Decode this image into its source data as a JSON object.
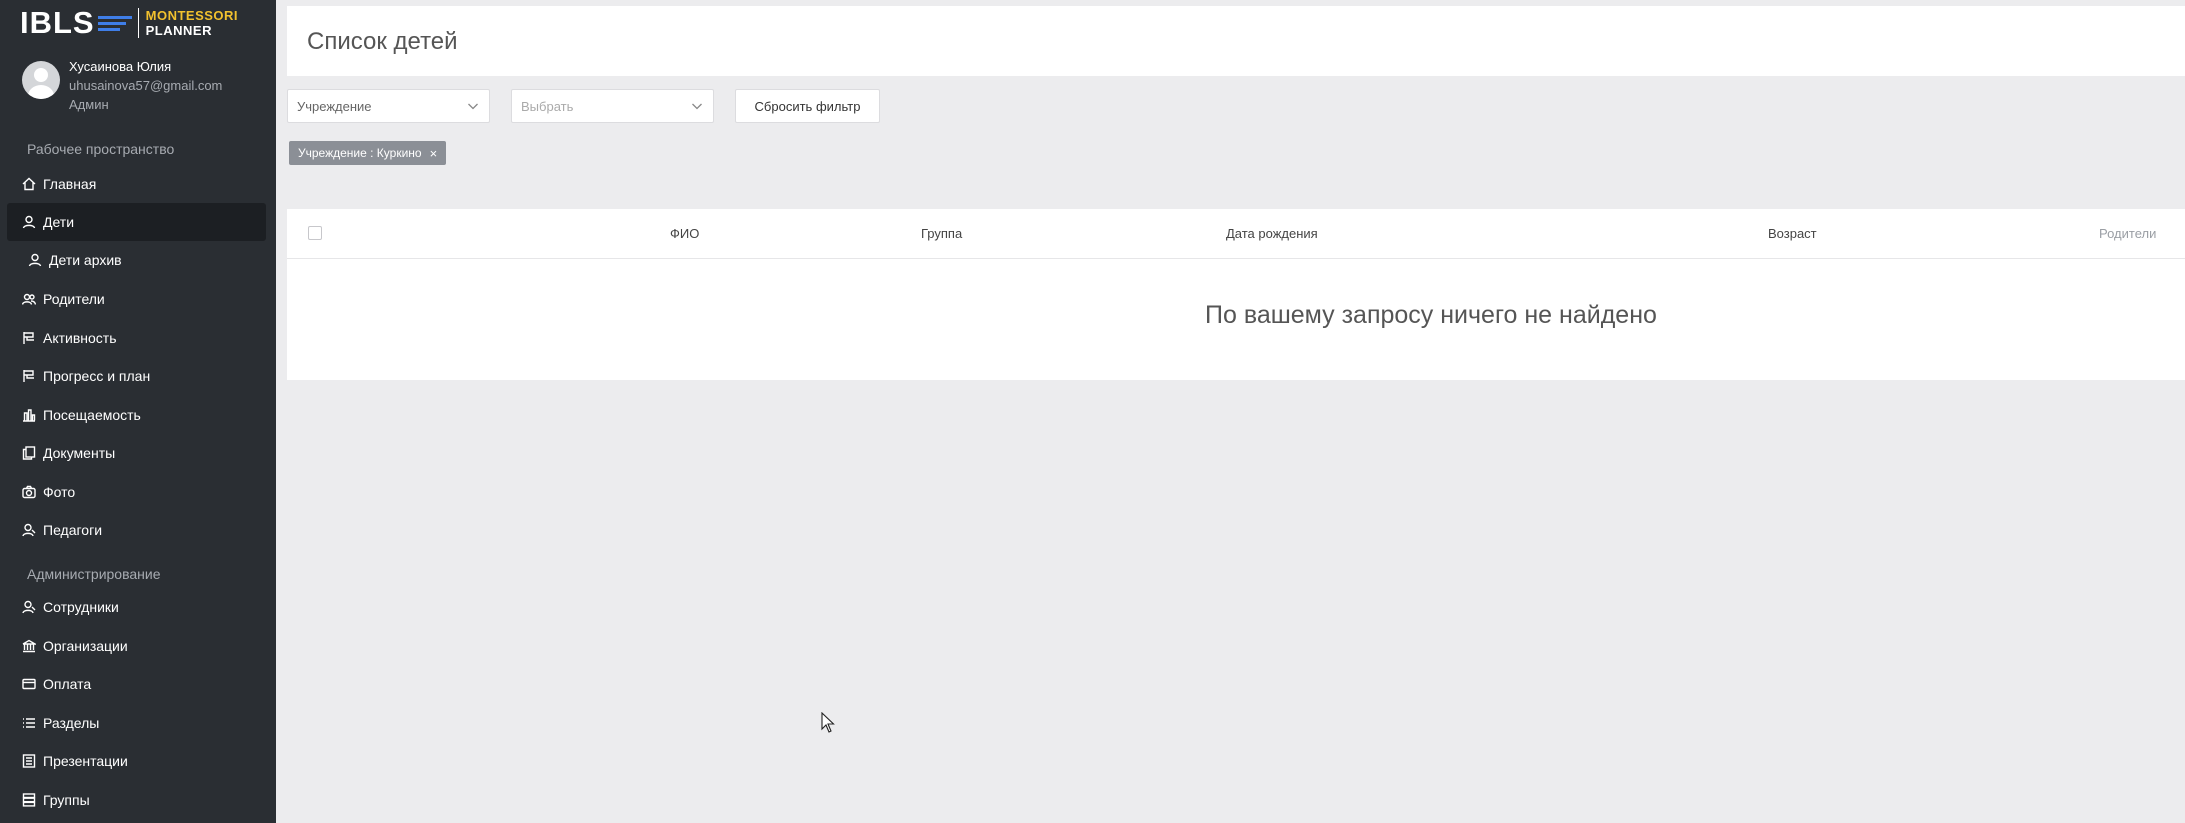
{
  "logo": {
    "wordmark": "IBLS",
    "line1": "MONTESSORI",
    "line2": "PLANNER",
    "accent_color": "#3f7ee8",
    "secondary_color": "#f2c12e"
  },
  "profile": {
    "name": "Хусаинова Юлия",
    "email": "uhusainova57@gmail.com",
    "role": "Админ"
  },
  "sidebar": {
    "workspace_title": "Рабочее пространство",
    "admin_title": "Администрирование",
    "workspace_items": [
      {
        "label": "Главная",
        "icon": "home-icon"
      },
      {
        "label": "Дети",
        "icon": "user-icon",
        "active": true
      },
      {
        "label": "Дети архив",
        "icon": "user-icon"
      },
      {
        "label": "Родители",
        "icon": "users-icon"
      },
      {
        "label": "Активность",
        "icon": "flag-icon"
      },
      {
        "label": "Прогресс и план",
        "icon": "flag-icon"
      },
      {
        "label": "Посещаемость",
        "icon": "bar-chart-icon"
      },
      {
        "label": "Документы",
        "icon": "document-icon"
      },
      {
        "label": "Фото",
        "icon": "camera-icon"
      },
      {
        "label": "Педагоги",
        "icon": "teacher-icon"
      }
    ],
    "admin_items": [
      {
        "label": "Сотрудники",
        "icon": "staff-icon"
      },
      {
        "label": "Организации",
        "icon": "building-icon"
      },
      {
        "label": "Оплата",
        "icon": "credit-card-icon"
      },
      {
        "label": "Разделы",
        "icon": "list-icon"
      },
      {
        "label": "Презентации",
        "icon": "presentation-icon"
      },
      {
        "label": "Группы",
        "icon": "stack-icon"
      }
    ]
  },
  "header": {
    "title": "Список детей"
  },
  "filters": {
    "institution_select": "Учреждение",
    "second_select_placeholder": "Выбрать",
    "reset_button": "Сбросить фильтр",
    "active_tag": "Учреждение : Куркино",
    "tag_close": "×"
  },
  "table": {
    "columns": [
      "ФИО",
      "Группа",
      "Дата рождения",
      "Возраст",
      "Родители"
    ],
    "empty_message": "По вашему запросу ничего не найдено"
  }
}
